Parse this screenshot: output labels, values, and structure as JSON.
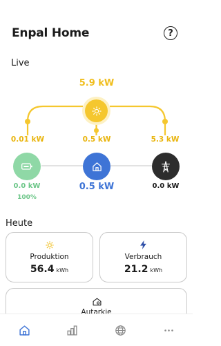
{
  "header": {
    "title": "Enpal Home",
    "help_icon": "?"
  },
  "live": {
    "section_title": "Live",
    "production_total": "5.9 kW",
    "to_battery": "0.01 kW",
    "to_house": "0.5 kW",
    "to_grid": "5.3 kW",
    "battery_value": "0.0 kW",
    "battery_percent": "100%",
    "house_value": "0.5 kW",
    "grid_value": "0.0 kW",
    "colors": {
      "solar": "#f5c72e",
      "battery": "#7ccf95",
      "house": "#3e74d6",
      "grid": "#2d2d2d"
    }
  },
  "today": {
    "section_title": "Heute",
    "production": {
      "label": "Produktion",
      "value": "56.4",
      "unit": "kWh",
      "icon": "sun-icon"
    },
    "consumption": {
      "label": "Verbrauch",
      "value": "21.2",
      "unit": "kWh",
      "icon": "lightning-icon"
    },
    "autarky": {
      "label": "Autarkie",
      "icon": "house-icon"
    }
  },
  "nav": {
    "items": [
      {
        "icon": "home-icon",
        "active": true
      },
      {
        "icon": "bar-chart-icon",
        "active": false
      },
      {
        "icon": "globe-icon",
        "active": false
      },
      {
        "icon": "more-icon",
        "active": false
      }
    ]
  }
}
